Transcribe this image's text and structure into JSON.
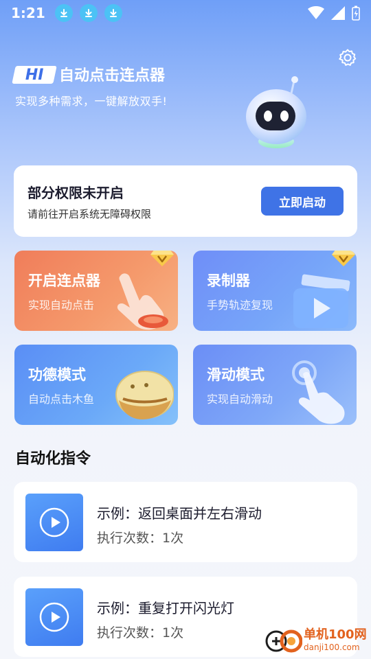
{
  "status_bar": {
    "time": "1:21",
    "icons": [
      "download-icon",
      "download-icon",
      "download-icon",
      "wifi-icon",
      "signal-icon",
      "battery-charging-icon"
    ]
  },
  "header": {
    "badge": "HI",
    "title": "自动点击连点器",
    "subtitle": "实现多种需求，一键解放双手!"
  },
  "permission": {
    "title": "部分权限未开启",
    "description": "请前往开启系统无障碍权限",
    "button": "立即启动"
  },
  "features": [
    {
      "title": "开启连点器",
      "subtitle": "实现自动点击",
      "vip": true,
      "icon": "tap-hand-icon"
    },
    {
      "title": "录制器",
      "subtitle": "手势轨迹复现",
      "vip": true,
      "icon": "play-clapper-icon"
    },
    {
      "title": "功德模式",
      "subtitle": "自动点击木鱼",
      "vip": false,
      "icon": "wooden-fish-icon"
    },
    {
      "title": "滑动模式",
      "subtitle": "实现自动滑动",
      "vip": false,
      "icon": "swipe-hand-icon"
    }
  ],
  "automation": {
    "section_title": "自动化指令",
    "commands": [
      {
        "title": "示例：返回桌面并左右滑动",
        "count": "执行次数：1次"
      },
      {
        "title": "示例：重复打开闪光灯",
        "count": "执行次数：1次"
      }
    ]
  },
  "watermark": {
    "line1": "单机100网",
    "line2": "danji100.com"
  },
  "colors": {
    "accent": "#3f73e6",
    "orange_card": "#f07d5a",
    "blue_card": "#6f8ef8"
  }
}
